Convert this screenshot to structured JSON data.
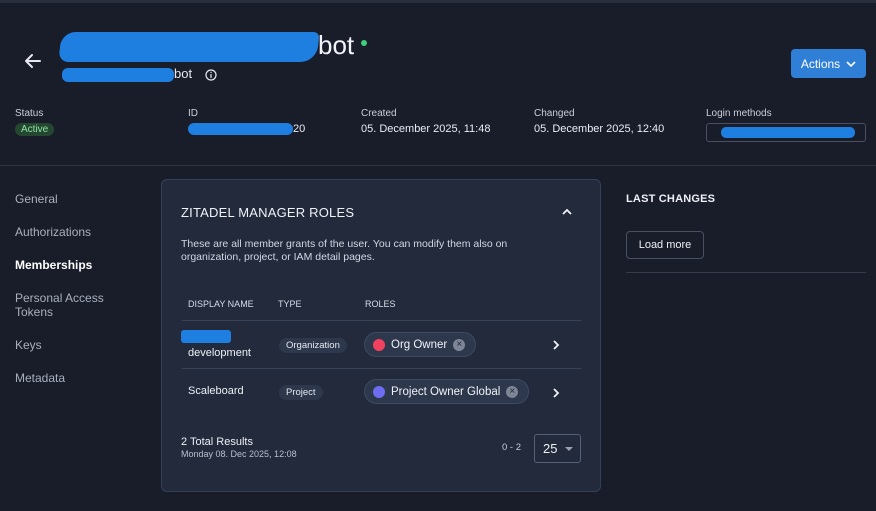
{
  "header": {
    "title_suffix": "bot",
    "subtitle_suffix": "bot",
    "actions_label": "Actions"
  },
  "meta": {
    "status_label": "Status",
    "status_value": "Active",
    "id_label": "ID",
    "id_suffix": "20",
    "created_label": "Created",
    "created_value": "05. December 2025, 11:48",
    "changed_label": "Changed",
    "changed_value": "05. December 2025, 12:40",
    "login_methods_label": "Login methods"
  },
  "nav": {
    "items": [
      {
        "label": "General"
      },
      {
        "label": "Authorizations"
      },
      {
        "label": "Memberships"
      },
      {
        "label": "Personal Access Tokens"
      },
      {
        "label": "Keys"
      },
      {
        "label": "Metadata"
      }
    ],
    "active_index": 2
  },
  "roles_card": {
    "title": "ZITADEL MANAGER ROLES",
    "description": "These are all member grants of the user. You can modify them also on organization, project, or IAM detail pages.",
    "columns": [
      "DISPLAY NAME",
      "TYPE",
      "ROLES"
    ],
    "rows": [
      {
        "display_name": "development",
        "type": "Organization",
        "role": "Org Owner",
        "role_color": "#f2415f"
      },
      {
        "display_name": "Scaleboard",
        "type": "Project",
        "role": "Project Owner Global",
        "role_color": "#6e6cf0"
      }
    ],
    "total_results": "2 Total Results",
    "timestamp": "Monday 08. Dec 2025, 12:08",
    "range": "0 - 2",
    "page_size": "25"
  },
  "last_changes": {
    "title": "LAST CHANGES",
    "load_more": "Load more"
  },
  "colors": {
    "background": "#191d2a",
    "card": "#222a3c",
    "accent": "#2f7fd6",
    "status_dot": "#3ed07a"
  }
}
